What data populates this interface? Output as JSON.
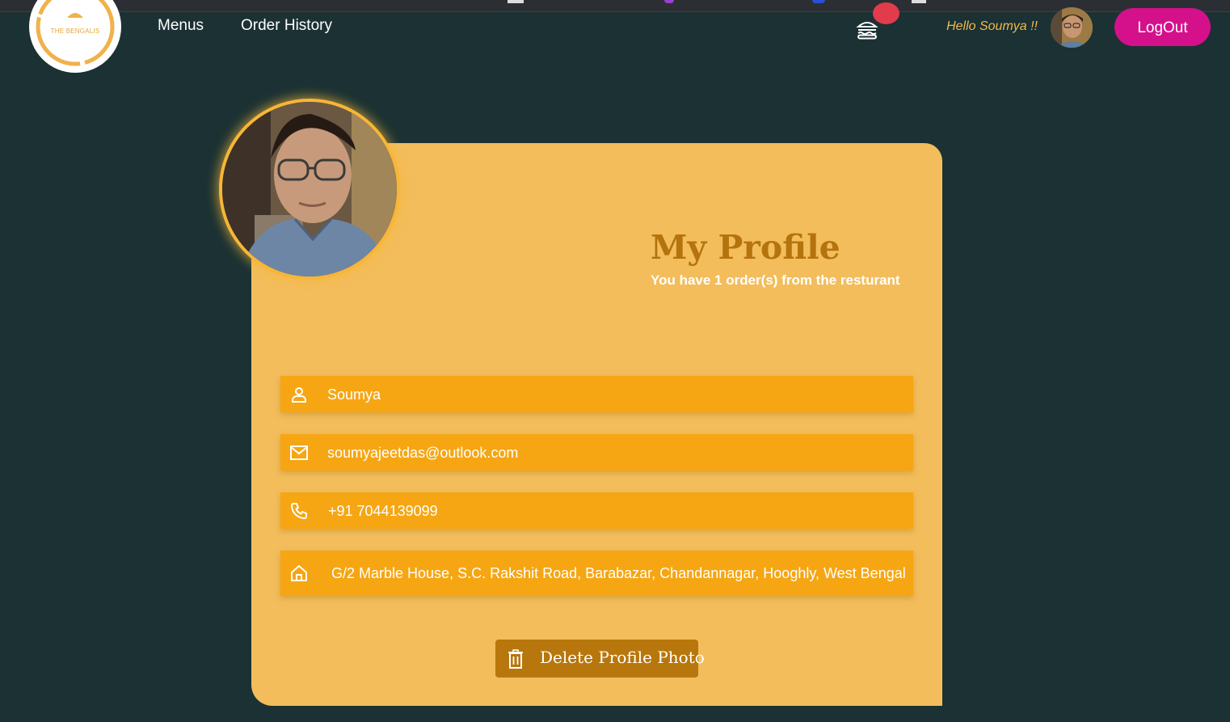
{
  "nav": {
    "logo_text": "THE BENGALIS",
    "links": [
      {
        "label": "Menus"
      },
      {
        "label": "Order History"
      }
    ],
    "cart_icon": "burger-icon",
    "greeting": "Hello Soumya !!",
    "logout_label": "LogOut"
  },
  "profile": {
    "title": "My Profile",
    "subtitle": "You have 1 order(s) from the resturant",
    "fields": {
      "name": {
        "icon": "user-icon",
        "value": "Soumya"
      },
      "email": {
        "icon": "mail-icon",
        "value": "soumyajeetdas@outlook.com"
      },
      "phone": {
        "icon": "phone-icon",
        "value": "+91 7044139099"
      },
      "address": {
        "icon": "home-icon",
        "value": "G/2 Marble House, S.C. Rakshit Road, Barabazar, Chandannagar, Hooghly, West Bengal"
      }
    },
    "delete_label": "Delete Profile Photo"
  },
  "colors": {
    "background": "#1b3133",
    "card": "#f3bd5c",
    "field": "#f6a613",
    "title": "#b5730d",
    "logout": "#d4108b",
    "delete_button": "#b8770c",
    "greeting": "#f3b84a"
  }
}
